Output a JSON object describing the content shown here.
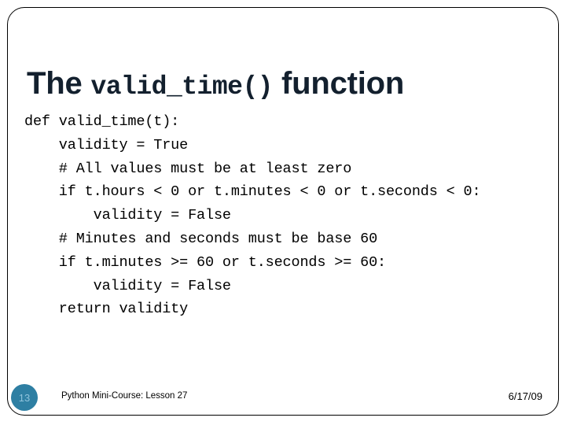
{
  "slide": {
    "title": {
      "prefix": "The ",
      "code": "valid_time()",
      "suffix": " function"
    },
    "code_lines": [
      "def valid_time(t):",
      "    validity = True",
      "    # All values must be at least zero",
      "    if t.hours < 0 or t.minutes < 0 or t.seconds < 0:",
      "        validity = False",
      "    # Minutes and seconds must be base 60",
      "    if t.minutes >= 60 or t.seconds >= 60:",
      "        validity = False",
      "    return validity"
    ],
    "footer": {
      "slide_number": "13",
      "text": "Python Mini-Course: Lesson 27",
      "date": "6/17/09"
    },
    "colors": {
      "title": "#13202E",
      "badge_fill": "#2E7FA3",
      "badge_text": "#8FC3DC",
      "code": "#000000",
      "frame": "#000000",
      "background": "#FFFFFF"
    }
  }
}
